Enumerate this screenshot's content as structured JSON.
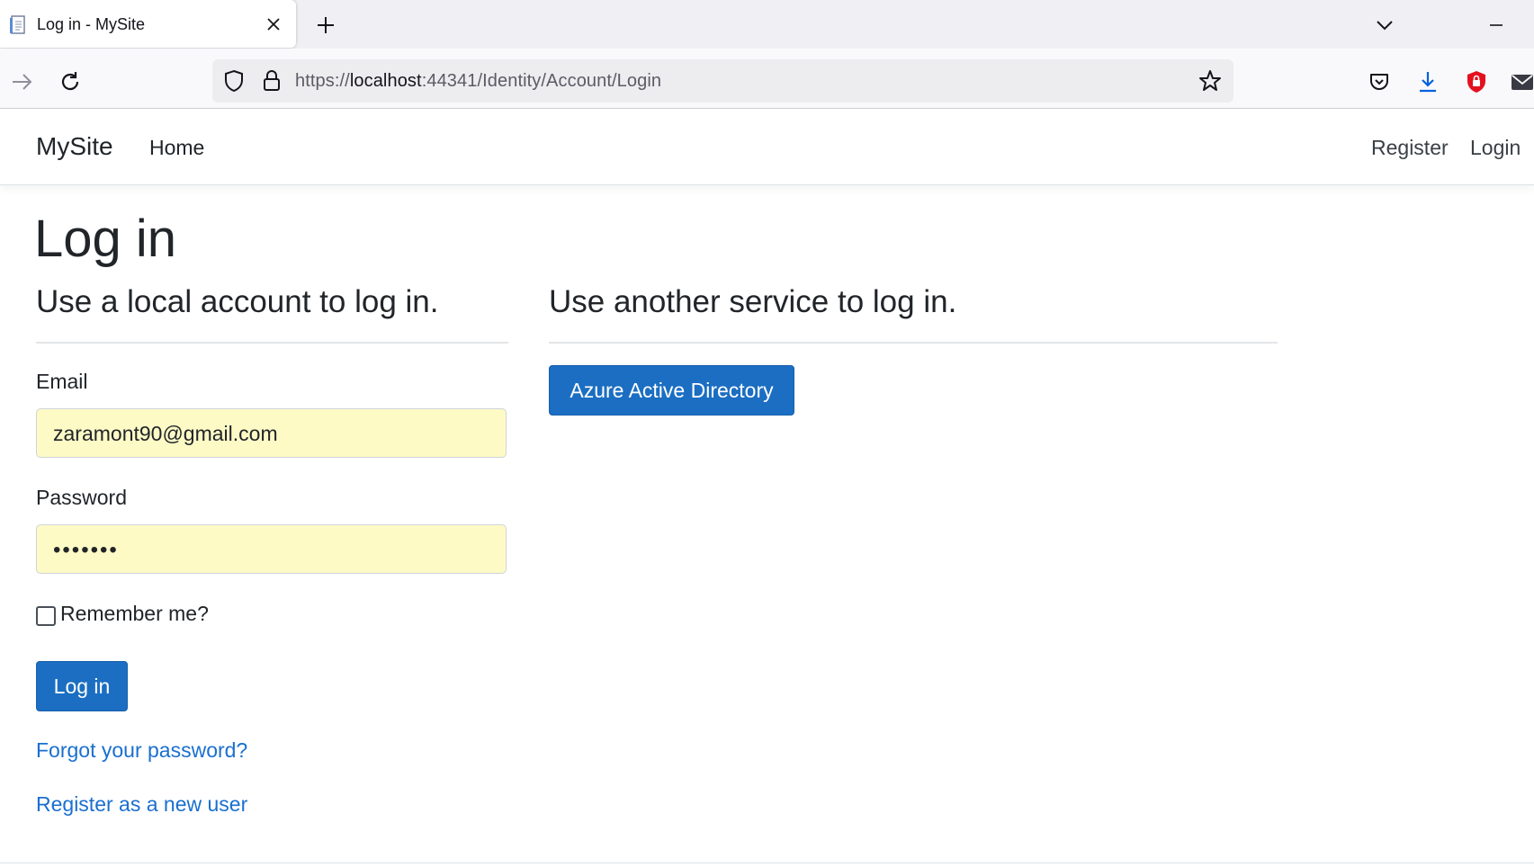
{
  "browser": {
    "tab_title": "Log in - MySite",
    "url_scheme": "https://",
    "url_host": "localhost",
    "url_rest": ":44341/Identity/Account/Login",
    "icons": [
      "page-favicon-icon",
      "close-icon",
      "plus-icon",
      "chevron-down-icon",
      "minimize-icon",
      "forward-arrow-icon",
      "reload-icon",
      "shield-icon",
      "lock-icon",
      "star-icon",
      "pocket-icon",
      "download-icon",
      "extension-shield-icon",
      "mail-icon"
    ]
  },
  "site": {
    "brand": "MySite",
    "nav_home": "Home",
    "nav_register": "Register",
    "nav_login": "Login"
  },
  "page": {
    "title": "Log in",
    "local_heading": "Use a local account to log in.",
    "external_heading": "Use another service to log in.",
    "email_label": "Email",
    "email_value": "zaramont90@gmail.com",
    "password_label": "Password",
    "password_value": "•••••••",
    "remember_label": "Remember me?",
    "login_button": "Log in",
    "forgot_link": "Forgot your password?",
    "register_link": "Register as a new user",
    "external_button": "Azure Active Directory"
  },
  "colors": {
    "primary": "#1b6ec2",
    "link": "#1a6fcf",
    "autofill": "#fefac6"
  }
}
